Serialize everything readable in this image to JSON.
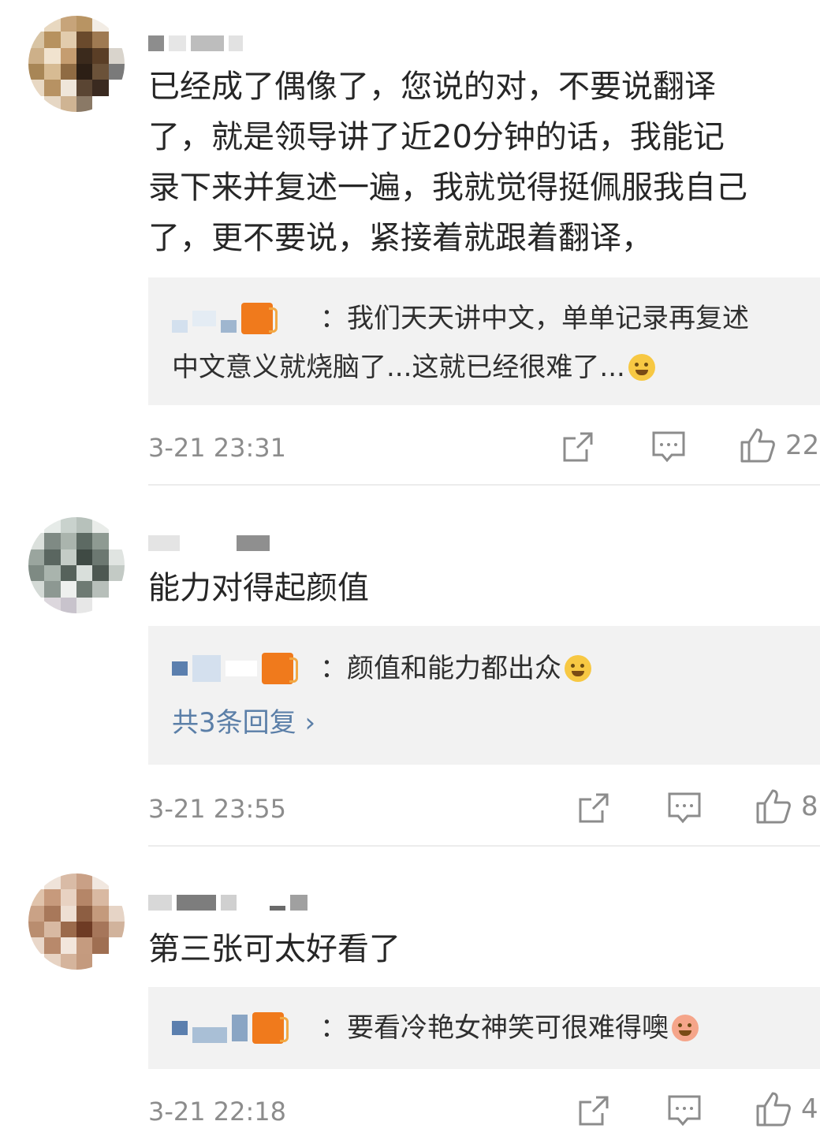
{
  "colors": {
    "text": "#262626",
    "meta": "#8c8c8c",
    "reply_bg": "#f2f2f2",
    "link": "#5b7fa8",
    "vip_badge": "#f07a1c"
  },
  "comments": [
    {
      "content_lines": [
        "已经成了偶像了，您说的对，不要说翻译",
        "了，就是领导讲了近20分钟的话，我能记",
        "录下来并复述一遍，我就觉得挺佩服我自己",
        "了，更不要说，紧接着就跟着翻译，"
      ],
      "reply": {
        "text_line1": "：我们天天讲中文，单单记录再复述",
        "text_line2": "中文意义就烧脑了...这就已经很难了...",
        "emoji": "laugh-cry-emoji"
      },
      "timestamp": "3-21 23:31",
      "likes": "22"
    },
    {
      "content_lines": [
        "能力对得起颜值"
      ],
      "reply": {
        "text_line1": "：颜值和能力都出众",
        "emoji": "scream-emoji"
      },
      "more_replies": "共3条回复 ›",
      "timestamp": "3-21 23:55",
      "likes": "8"
    },
    {
      "content_lines": [
        "第三张可太好看了"
      ],
      "reply": {
        "text_line1": "：要看冷艳女神笑可很难得噢",
        "emoji": "cute-emoji"
      },
      "timestamp": "3-21 22:18",
      "likes": "4"
    }
  ]
}
